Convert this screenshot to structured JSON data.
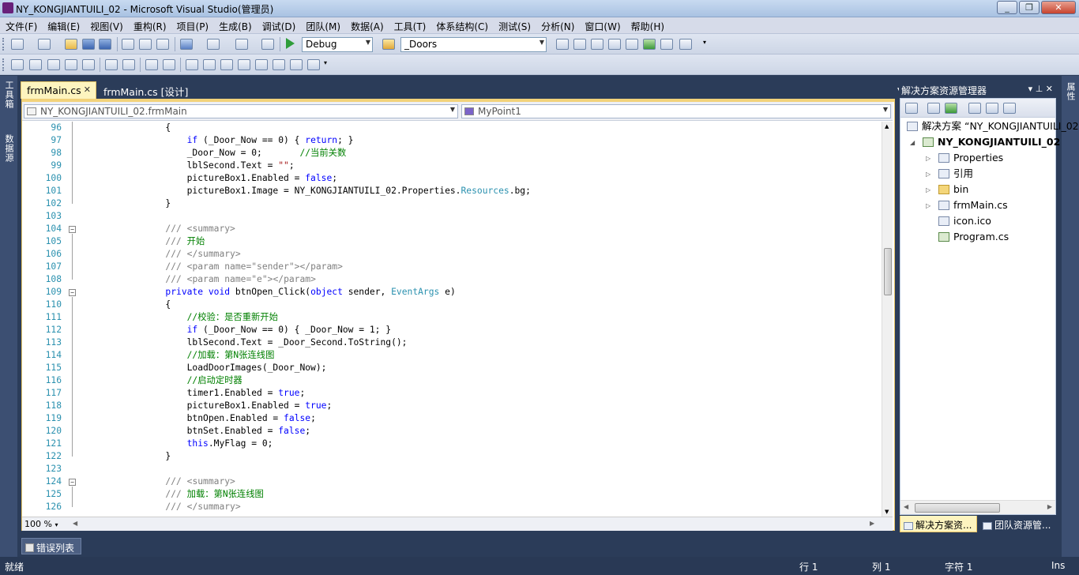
{
  "window": {
    "title": "NY_KONGJIANTUILI_02 - Microsoft Visual Studio(管理员)",
    "min": "0",
    "max": "1",
    "close": "r"
  },
  "menu": [
    "文件(F)",
    "编辑(E)",
    "视图(V)",
    "重构(R)",
    "项目(P)",
    "生成(B)",
    "调试(D)",
    "团队(M)",
    "数据(A)",
    "工具(T)",
    "体系结构(C)",
    "测试(S)",
    "分析(N)",
    "窗口(W)",
    "帮助(H)"
  ],
  "toolbar": {
    "config": "Debug",
    "find": "_Doors"
  },
  "left_strip": {
    "toolbox": "工具箱",
    "datasources": "数据源"
  },
  "right_strip": {
    "properties": "属性"
  },
  "doc_tabs": [
    {
      "label": "frmMain.cs",
      "active": true
    },
    {
      "label": "frmMain.cs [设计]",
      "active": false
    }
  ],
  "nav": {
    "type_combo": "NY_KONGJIANTUILI_02.frmMain",
    "member_combo": "MyPoint1"
  },
  "code_lines": [
    {
      "n": "96",
      "html": "        {"
    },
    {
      "n": "97",
      "html": "            <span class=\"kw\">if</span> (_Door_Now == 0) { <span class=\"kw\">return</span>; }"
    },
    {
      "n": "98",
      "html": "            _Door_Now = 0;       <span class=\"cm\">//当前关数</span>"
    },
    {
      "n": "99",
      "html": "            lblSecond.Text = <span class=\"st\">\"\"</span>;"
    },
    {
      "n": "100",
      "html": "            pictureBox1.Enabled = <span class=\"kw\">false</span>;"
    },
    {
      "n": "101",
      "html": "            pictureBox1.Image = NY_KONGJIANTUILI_02.Properties.<span class=\"ty\">Resources</span>.bg;"
    },
    {
      "n": "102",
      "html": "        }"
    },
    {
      "n": "103",
      "html": ""
    },
    {
      "n": "104",
      "html": "        <span class=\"gy\">///</span> <span class=\"gy\">&lt;summary&gt;</span>"
    },
    {
      "n": "105",
      "html": "        <span class=\"gy\">///</span> <span class=\"cm\">开始</span>"
    },
    {
      "n": "106",
      "html": "        <span class=\"gy\">///</span> <span class=\"gy\">&lt;/summary&gt;</span>"
    },
    {
      "n": "107",
      "html": "        <span class=\"gy\">///</span> <span class=\"gy\">&lt;param name=\"sender\"&gt;&lt;/param&gt;</span>"
    },
    {
      "n": "108",
      "html": "        <span class=\"gy\">///</span> <span class=\"gy\">&lt;param name=\"e\"&gt;&lt;/param&gt;</span>"
    },
    {
      "n": "109",
      "html": "        <span class=\"kw\">private</span> <span class=\"kw\">void</span> btnOpen_Click(<span class=\"kw\">object</span> sender, <span class=\"ty\">EventArgs</span> e)"
    },
    {
      "n": "110",
      "html": "        {"
    },
    {
      "n": "111",
      "html": "            <span class=\"cm\">//校验：是否重新开始</span>"
    },
    {
      "n": "112",
      "html": "            <span class=\"kw\">if</span> (_Door_Now == 0) { _Door_Now = 1; }"
    },
    {
      "n": "113",
      "html": "            lblSecond.Text = _Door_Second.ToString();"
    },
    {
      "n": "114",
      "html": "            <span class=\"cm\">//加载：第N张连线图</span>"
    },
    {
      "n": "115",
      "html": "            LoadDoorImages(_Door_Now);"
    },
    {
      "n": "116",
      "html": "            <span class=\"cm\">//启动定时器</span>"
    },
    {
      "n": "117",
      "html": "            timer1.Enabled = <span class=\"kw\">true</span>;"
    },
    {
      "n": "118",
      "html": "            pictureBox1.Enabled = <span class=\"kw\">true</span>;"
    },
    {
      "n": "119",
      "html": "            btnOpen.Enabled = <span class=\"kw\">false</span>;"
    },
    {
      "n": "120",
      "html": "            btnSet.Enabled = <span class=\"kw\">false</span>;"
    },
    {
      "n": "121",
      "html": "            <span class=\"kw\">this</span>.MyFlag = 0;"
    },
    {
      "n": "122",
      "html": "        }"
    },
    {
      "n": "123",
      "html": ""
    },
    {
      "n": "124",
      "html": "        <span class=\"gy\">///</span> <span class=\"gy\">&lt;summary&gt;</span>"
    },
    {
      "n": "125",
      "html": "        <span class=\"gy\">///</span> <span class=\"cm\">加载：第N张连线图</span>"
    },
    {
      "n": "126",
      "html": "        <span class=\"gy\">///</span> <span class=\"gy\">&lt;/summary&gt;</span>"
    }
  ],
  "fold_markers": [
    "104",
    "109",
    "124"
  ],
  "editor": {
    "zoom": "100 %"
  },
  "solution_explorer": {
    "title": "解决方案资源管理器",
    "header_buttons": "▾ ⊥ ✕",
    "solution": "解决方案 “NY_KONGJIANTUILI_02”",
    "project": "NY_KONGJIANTUILI_02",
    "items": [
      "Properties",
      "引用",
      "bin",
      "frmMain.cs",
      "icon.ico",
      "Program.cs"
    ]
  },
  "side_tabs": [
    "解决方案资...",
    "团队资源管..."
  ],
  "bottom_tab": "错误列表",
  "status": {
    "ready": "就绪",
    "row": "行 1",
    "col": "列 1",
    "char": "字符 1",
    "ins": "Ins"
  },
  "colors": {
    "vs_blue": "#2b3c59",
    "tab_yellow": "#fdf4bf",
    "keyword": "#0000ff",
    "comment": "#008000",
    "type": "#2b91af"
  }
}
